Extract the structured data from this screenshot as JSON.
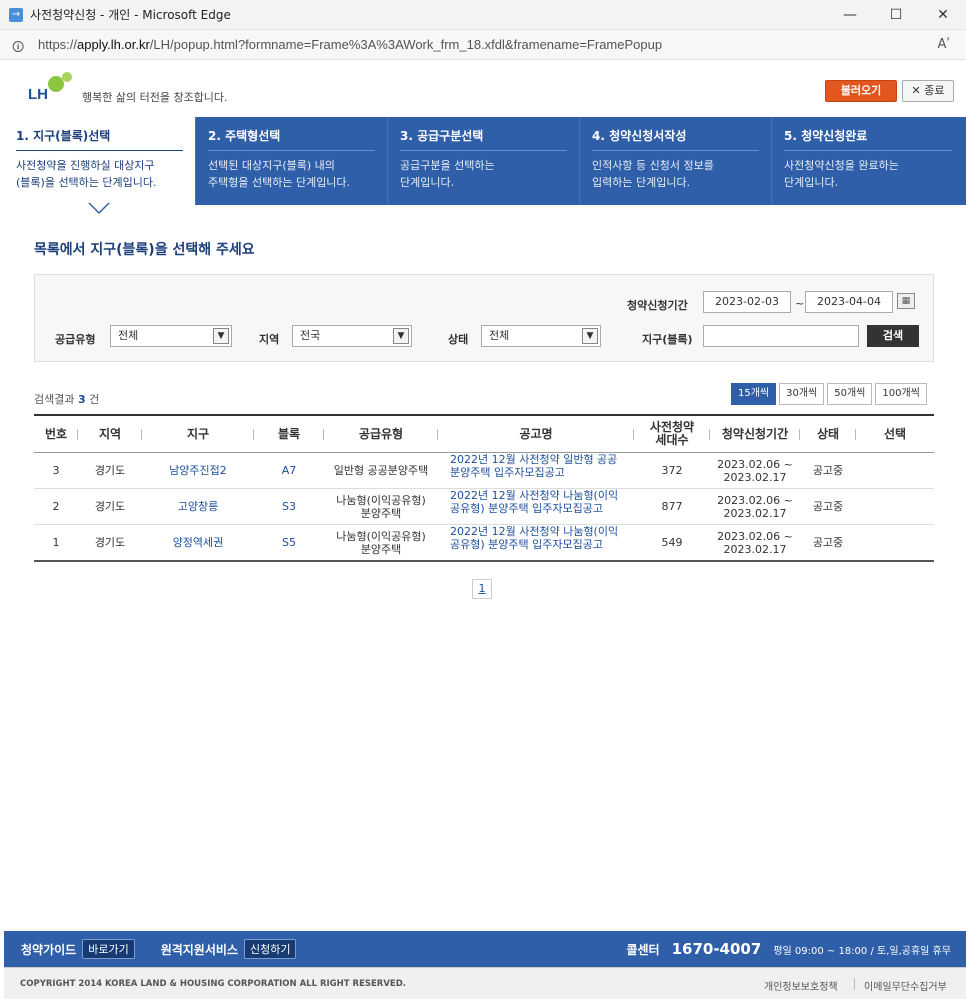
{
  "window": {
    "title": "사전청약신청 - 개인 - Microsoft Edge",
    "url_prefix": "https://",
    "url_domain": "apply.lh.or.kr",
    "url_path": "/LH/popup.html?formname=Frame%3A%3AWork_frm_18.xfdl&framename=FramePopup",
    "minimize": "—",
    "maximize": "☐",
    "close": "✕",
    "read_aloud": "Aʹ"
  },
  "header": {
    "logo_text": "LH",
    "slogan": "행복한 삶의 터전을 창조합니다.",
    "load_button": "불러오기",
    "close_button": "✕ 종료"
  },
  "steps": [
    {
      "title": "1. 지구(블록)선택",
      "desc1": "사전청약을 진행하실 대상지구",
      "desc2": "(블록)을 선택하는 단계입니다."
    },
    {
      "title": "2. 주택형선택",
      "desc1": "선택된 대상지구(블록) 내의",
      "desc2": "주택형을 선택하는 단계입니다."
    },
    {
      "title": "3. 공급구분선택",
      "desc1": "공급구분을 선택하는",
      "desc2": "단계입니다."
    },
    {
      "title": "4. 청약신청서작성",
      "desc1": "인적사항 등 신청서 정보를",
      "desc2": "입력하는 단계입니다."
    },
    {
      "title": "5. 청약신청완료",
      "desc1": "사전청약신청을 완료하는",
      "desc2": "단계입니다."
    }
  ],
  "page_heading": "목록에서 지구(블록)을 선택해 주세요",
  "search": {
    "period_label": "청약신청기간",
    "date_from": "2023-02-03",
    "date_sep": "~",
    "date_to": "2023-04-04",
    "supply_type_label": "공급유형",
    "supply_type_value": "전체",
    "region_label": "지역",
    "region_value": "전국",
    "status_label": "상태",
    "status_value": "전체",
    "district_label": "지구(블록)",
    "district_value": "",
    "search_button": "검색"
  },
  "results": {
    "count_prefix": "검색결과",
    "count": "3",
    "count_suffix": "건"
  },
  "page_sizes": [
    "15개씩",
    "30개씩",
    "50개씩",
    "100개씩"
  ],
  "table": {
    "headers": [
      "번호",
      "지역",
      "지구",
      "블록",
      "공급유형",
      "공고명",
      "사전청약\n세대수",
      "청약신청기간",
      "상태",
      "선택"
    ],
    "rows": [
      {
        "no": "3",
        "region": "경기도",
        "district": "남양주진접2",
        "block": "A7",
        "type1": "일반형 공공분양주택",
        "type2": "",
        "notice1": "2022년 12월 사전청약 일반형 공공",
        "notice2": "분양주택 입주자모집공고",
        "units": "372",
        "period1": "2023.02.06 ~",
        "period2": "2023.02.17",
        "status": "공고중",
        "select": ""
      },
      {
        "no": "2",
        "region": "경기도",
        "district": "고양창릉",
        "block": "S3",
        "type1": "나눔형(이익공유형)",
        "type2": "분양주택",
        "notice1": "2022년 12월 사전청약 나눔형(이익",
        "notice2": "공유형) 분양주택 입주자모집공고",
        "units": "877",
        "period1": "2023.02.06 ~",
        "period2": "2023.02.17",
        "status": "공고중",
        "select": ""
      },
      {
        "no": "1",
        "region": "경기도",
        "district": "양정역세권",
        "block": "S5",
        "type1": "나눔형(이익공유형)",
        "type2": "분양주택",
        "notice1": "2022년 12월 사전청약 나눔형(이익",
        "notice2": "공유형) 분양주택 입주자모집공고",
        "units": "549",
        "period1": "2023.02.06 ~",
        "period2": "2023.02.17",
        "status": "공고중",
        "select": ""
      }
    ]
  },
  "pagination": {
    "current": "1"
  },
  "footer": {
    "guide_label": "청약가이드",
    "guide_button": "바로가기",
    "remote_label": "원격지원서비스",
    "remote_button": "신청하기",
    "callcenter_label": "콜센터",
    "phone": "1670-4007",
    "hours": "평일 09:00 ~ 18:00 / 토,일,공휴일 휴무",
    "copyright": "COPYRIGHT 2014 KOREA LAND & HOUSING CORPORATION ALL RIGHT RESERVED.",
    "privacy": "개인정보보호정책",
    "email_refusal": "이메일무단수집거부"
  }
}
